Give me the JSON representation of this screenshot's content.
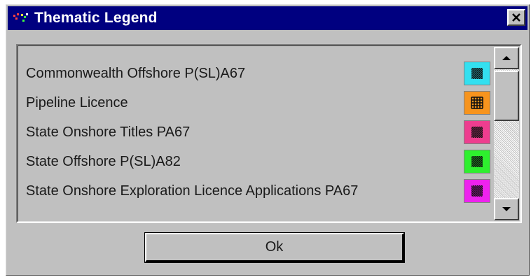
{
  "window": {
    "title": "Thematic Legend",
    "close_label": "×"
  },
  "legend": {
    "items": [
      {
        "label": "Commonwealth Offshore P(SL)A67",
        "color": "#33e0f0",
        "pattern": "diagonal-hatch"
      },
      {
        "label": "Pipeline Licence",
        "color": "#f7941d",
        "pattern": "grid"
      },
      {
        "label": "State Onshore Titles PA67",
        "color": "#ee3d8f",
        "pattern": "diagonal-hatch"
      },
      {
        "label": "State Offshore P(SL)A82",
        "color": "#2ef02e",
        "pattern": "diagonal-hatch"
      },
      {
        "label": "State Onshore Exploration Licence Applications PA67",
        "color": "#ee22ee",
        "pattern": "back-diagonal-hatch"
      }
    ]
  },
  "scrollbar": {
    "up_icon": "arrow-up-icon",
    "down_icon": "arrow-down-icon"
  },
  "buttons": {
    "ok_label": "Ok"
  }
}
